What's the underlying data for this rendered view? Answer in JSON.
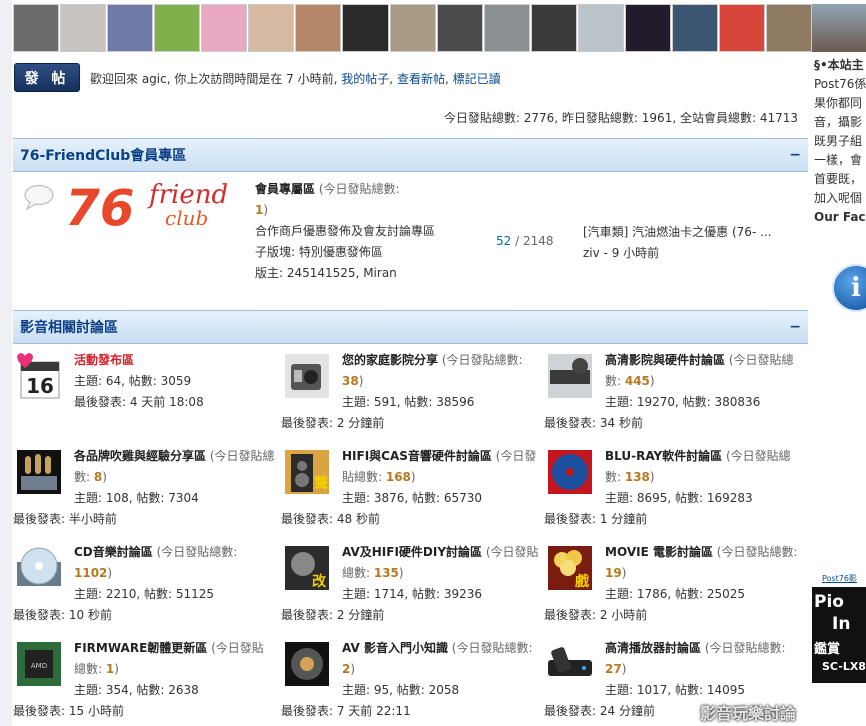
{
  "avatars": [
    {
      "name": "avatar-1",
      "color": "#6b6b6b"
    },
    {
      "name": "avatar-2",
      "color": "#c9c4c0"
    },
    {
      "name": "avatar-3",
      "color": "#6f7aa8"
    },
    {
      "name": "avatar-4",
      "color": "#7fb04c"
    },
    {
      "name": "avatar-5",
      "color": "#e9a8c2"
    },
    {
      "name": "avatar-6",
      "color": "#d6b9a3"
    },
    {
      "name": "avatar-7",
      "color": "#b48768"
    },
    {
      "name": "avatar-8",
      "color": "#2a2a2a"
    },
    {
      "name": "avatar-9",
      "color": "#a99a86"
    },
    {
      "name": "avatar-10",
      "color": "#4a4a4a"
    },
    {
      "name": "avatar-11",
      "color": "#8a8f93"
    },
    {
      "name": "avatar-12",
      "color": "#3a3a3a"
    },
    {
      "name": "avatar-13",
      "color": "#b9c3c9"
    },
    {
      "name": "avatar-14",
      "color": "#221b2c"
    },
    {
      "name": "avatar-15",
      "color": "#3c5672"
    },
    {
      "name": "avatar-16",
      "color": "#d8463b"
    },
    {
      "name": "avatar-17",
      "color": "#8f7b62"
    }
  ],
  "post_button": "發 帖",
  "welcome": {
    "text": "歡迎回來 agic, 你上次訪問時間是在 7 小時前,",
    "my_posts": "我的帖子",
    "sep1": ",",
    "new_posts": "查看新帖",
    "sep2": ",",
    "mark_read": "標記已讀"
  },
  "stats_line": "今日發貼總數: 2776, 昨日發貼總數: 1961, 全站會員總數: 41713",
  "categories": {
    "club": {
      "title": "76-FriendClub會員專區",
      "collapse": "−"
    },
    "av": {
      "title": "影音相關討論區",
      "collapse": "−"
    }
  },
  "club_forum": {
    "logo_big": "76",
    "logo_friend": "friend",
    "logo_club": "club",
    "name": "會員專屬區",
    "today_prefix": "(今日發貼總數:",
    "today_num": "1",
    "today_suffix": ")",
    "desc": "合作商戶優惠發佈及會友討論專區",
    "sub": "子版塊: 特別優惠發佈區",
    "mod": "版主: 245141525, Miran",
    "topics": "52",
    "posts_sep": " / 2148",
    "last_post_title": "[汽車類] 汽油燃油卡之優惠 (76- ...",
    "last_post_by": "ziv - 9 小時前"
  },
  "forums": [
    {
      "name": "活動發布區",
      "red": true,
      "today": "",
      "today_num": "",
      "topics": "主題: 64, 帖數: 3059",
      "last": "最後發表: 4 天前 18:08",
      "icon": "calendar-icon",
      "icon_text": "16"
    },
    {
      "name": "您的家庭影院分享",
      "red": false,
      "today": "(今日發貼總數: ",
      "today_num": "38",
      "topics": "主題: 591, 帖數: 38596",
      "last": "最後發表: 2 分鐘前",
      "icon": "speaker-icon",
      "icon_text": ""
    },
    {
      "name": "高清影院與硬件討論區",
      "red": false,
      "today": "(今日發貼總數: ",
      "today_num": "445",
      "topics": "主題: 19270, 帖數: 380836",
      "last": "最後發表: 34 秒前",
      "icon": "av-receiver-icon",
      "icon_text": ""
    },
    {
      "name": "各品牌吹雞與經驗分享區",
      "red": false,
      "today": "(今日發貼總數: ",
      "today_num": "8",
      "topics": "主題: 108, 帖數: 7304",
      "last": "最後發表: 半小時前",
      "icon": "tube-amp-icon",
      "icon_text": ""
    },
    {
      "name": "HIFI與CAS音響硬件討論區",
      "red": false,
      "today": "(今日發貼總數: ",
      "today_num": "168",
      "topics": "主題: 3876, 帖數: 65730",
      "last": "最後發表: 48 秒前",
      "icon": "hifi-speaker-icon",
      "icon_text": ""
    },
    {
      "name": "BLU-RAY軟件討論區",
      "red": false,
      "today": "(今日發貼總數: ",
      "today_num": "138",
      "topics": "主題: 8695, 帖數: 169283",
      "last": "最後發表: 1 分鐘前",
      "icon": "bluray-disc-icon",
      "icon_text": ""
    },
    {
      "name": "CD音樂討論區",
      "red": false,
      "today": "(今日發貼總數: ",
      "today_num": "1102",
      "topics": "主題: 2210, 帖數: 51125",
      "last": "最後發表: 10 秒前",
      "icon": "cd-player-icon",
      "icon_text": ""
    },
    {
      "name": "AV及HIFI硬件DIY討論區",
      "red": false,
      "today": "(今日發貼總數: ",
      "today_num": "135",
      "topics": "主題: 1714, 帖數: 39236",
      "last": "最後發表: 2 分鐘前",
      "icon": "diy-tools-icon",
      "icon_text": ""
    },
    {
      "name": "MOVIE 電影討論區",
      "red": false,
      "today": "(今日發貼總數: ",
      "today_num": "19",
      "topics": "主題: 1786, 帖數: 25025",
      "last": "最後發表: 2 小時前",
      "icon": "popcorn-icon",
      "icon_text": ""
    },
    {
      "name": "FIRMWARE韌體更新區",
      "red": false,
      "today": "(今日發貼總數: ",
      "today_num": "1",
      "topics": "主題: 354, 帖數: 2638",
      "last": "最後發表: 15 小時前",
      "icon": "chip-icon",
      "icon_text": ""
    },
    {
      "name": "AV 影音入門小知識",
      "red": false,
      "today": "(今日發貼總數: ",
      "today_num": "2",
      "topics": "主題: 95, 帖數: 2058",
      "last": "最後發表: 7 天前 22:11",
      "icon": "speaker-cone-icon",
      "icon_text": ""
    },
    {
      "name": "高清播放器討論區",
      "red": false,
      "today": "(今日發貼總數: ",
      "today_num": "27",
      "topics": "主題: 1017, 帖數: 14095",
      "last": "最後發表: 24 分鐘前",
      "icon": "media-player-icon",
      "icon_text": ""
    }
  ],
  "right_col": {
    "lines": [
      "§•本站主",
      "Post76係",
      "果你都同",
      "音，攝影",
      "既男子組",
      "一樣，會",
      "首要既，",
      "加入呢個",
      "Our Fac"
    ],
    "info_glyph": "i",
    "ad_label": "Post76影",
    "ad_lines": [
      "Pio",
      "In",
      "鑑賞",
      "SC-LX8"
    ]
  },
  "watermark": "www.Post76.com\n影音玩樂討論"
}
